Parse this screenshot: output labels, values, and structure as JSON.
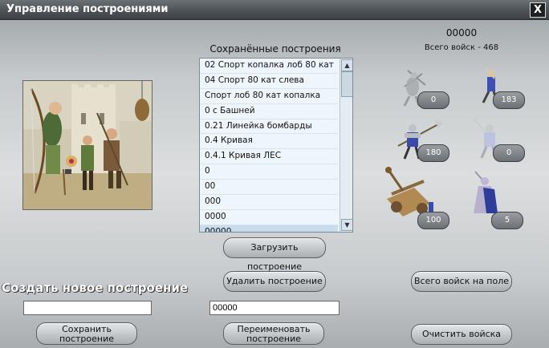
{
  "window": {
    "title": "Управление построениями",
    "close_label": "X"
  },
  "saved": {
    "title": "Сохранённые построения",
    "items": [
      "02 Спорт копалка лоб 80 кат",
      "04 Спорт  80 кат слева",
      "Спорт лоб 80 кат копалка",
      "0 с Башней",
      "0.21 Линейка бомбарды",
      "0.4 Кривая",
      "0.4.1 Кривая ЛЕС",
      "0",
      "00",
      "000",
      "0000",
      "00000"
    ],
    "selected_index": 11
  },
  "army": {
    "counter": "00000",
    "total": "Всего войск - 468",
    "units": [
      {
        "name": "crossbowman",
        "count": "0"
      },
      {
        "name": "slinger",
        "count": "183"
      },
      {
        "name": "halberdier",
        "count": "180"
      },
      {
        "name": "swordsman",
        "count": "0"
      },
      {
        "name": "catapult",
        "count": "100"
      },
      {
        "name": "monk",
        "count": "5"
      }
    ]
  },
  "buttons": {
    "load": "Загрузить построение",
    "delete": "Удалить построение",
    "total_on_field": "Всего войск на поле",
    "save_line1": "Сохранить",
    "save_line2": "построение",
    "rename_line1": "Переименовать",
    "rename_line2": "построение",
    "clear": "Очистить войска"
  },
  "create": {
    "label": "Создать новое построение",
    "new_name_value": "",
    "rename_value": "00000"
  }
}
